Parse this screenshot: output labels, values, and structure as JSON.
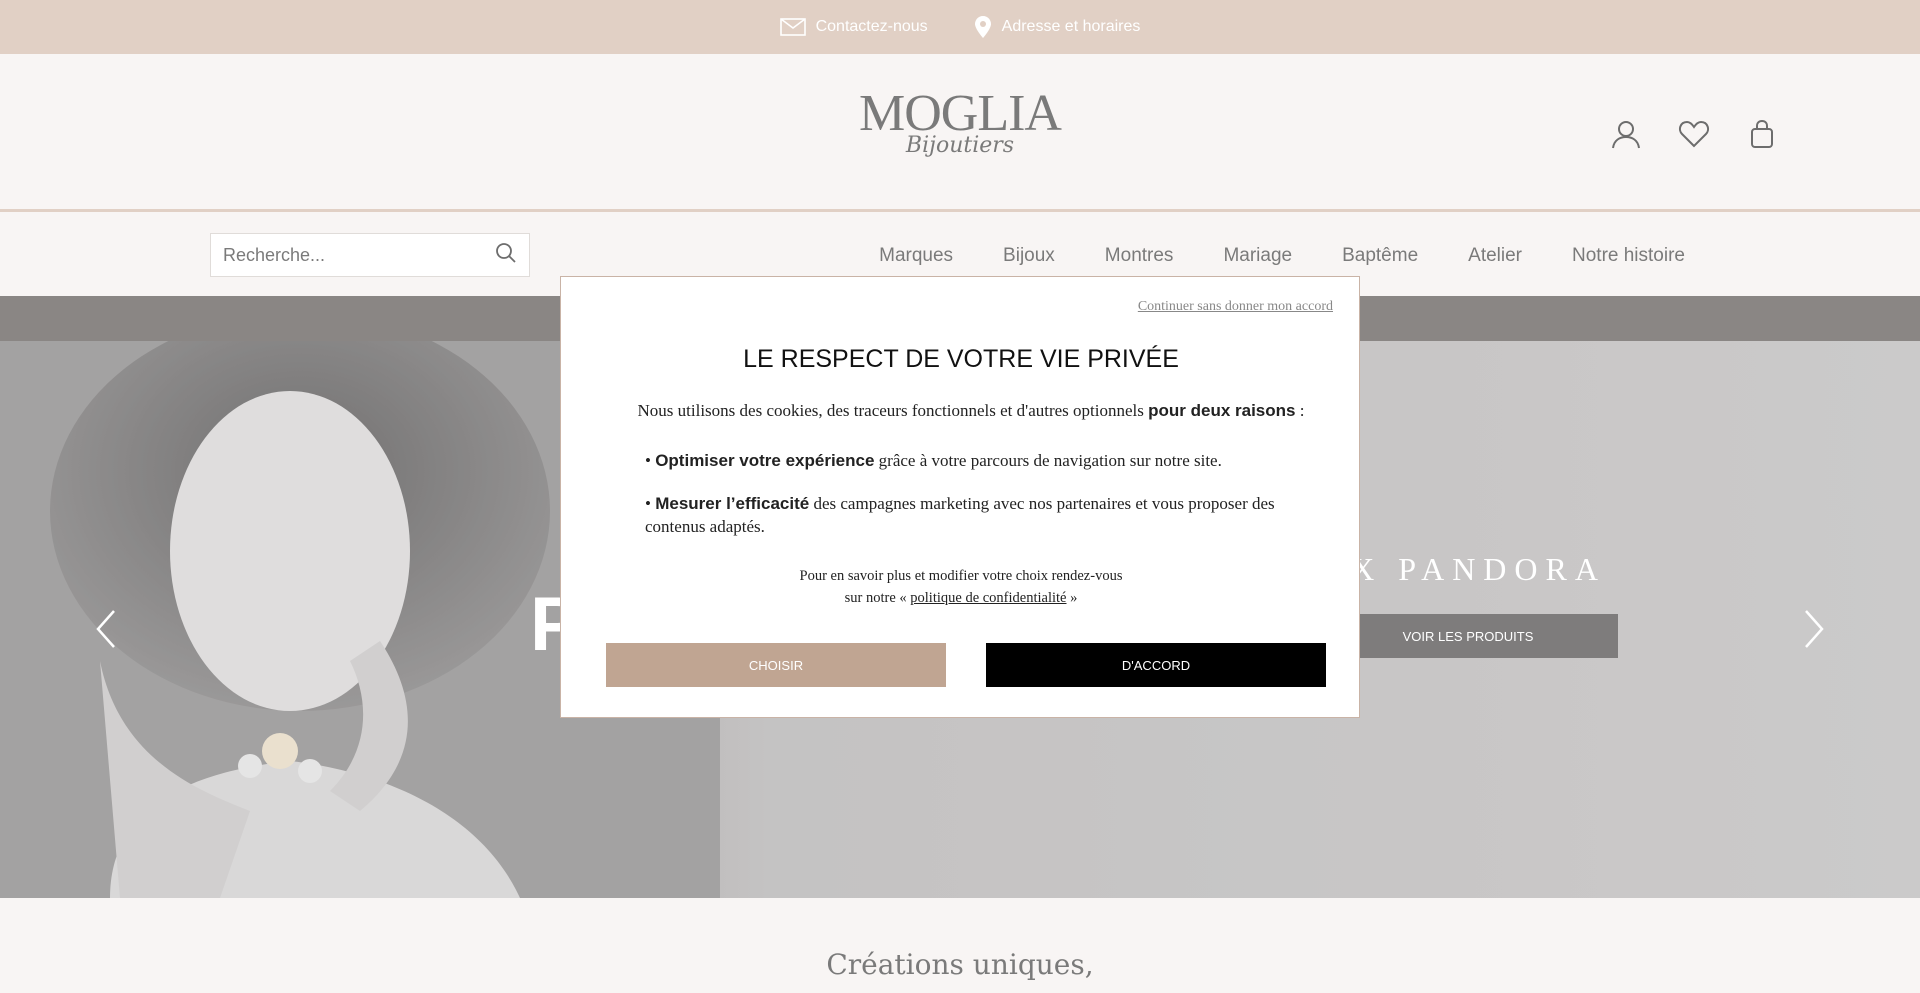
{
  "topbar": {
    "contact_label": "Contactez-nous",
    "address_label": "Adresse et horaires"
  },
  "header": {
    "logo_main": "MOGLIA",
    "logo_sub": "Bijoutiers",
    "icons": [
      "user-icon",
      "heart-icon",
      "bag-icon"
    ]
  },
  "search": {
    "placeholder": "Recherche..."
  },
  "nav": {
    "items": [
      "Marques",
      "Bijoux",
      "Montres",
      "Mariage",
      "Baptême",
      "Atelier",
      "Notre histoire"
    ]
  },
  "hero": {
    "title": "UX PANDORA",
    "big_letter": "P",
    "button_label": "VOIR LES PRODUITS"
  },
  "below": {
    "heading": "Créations uniques,"
  },
  "modal": {
    "skip_link": "Continuer sans donner mon accord",
    "title": "LE RESPECT DE VOTRE VIE PRIVÉE",
    "intro_text": "Nous utilisons des cookies, des traceurs fonctionnels et d'autres optionnels",
    "intro_bold": "pour deux raisons",
    "intro_end": " :",
    "bullet1_bold": "Optimiser votre expérience",
    "bullet1_text": " grâce à votre parcours de navigation sur notre site.",
    "bullet2_bold": "Mesurer l’efficacité",
    "bullet2_text": " des campagnes marketing avec nos partenaires et vous proposer des contenus adaptés.",
    "more_line1": "Pour en savoir plus et modifier votre choix rendez-vous",
    "more_line2_pre": "sur notre « ",
    "more_link": "politique de confidentialité",
    "more_line2_post": " »",
    "choose_label": "CHOISIR",
    "agree_label": "D'ACCORD"
  },
  "colors": {
    "topbar": "#d9c3b5",
    "accent": "#c0a592",
    "dark_strip": "#6a6462"
  }
}
